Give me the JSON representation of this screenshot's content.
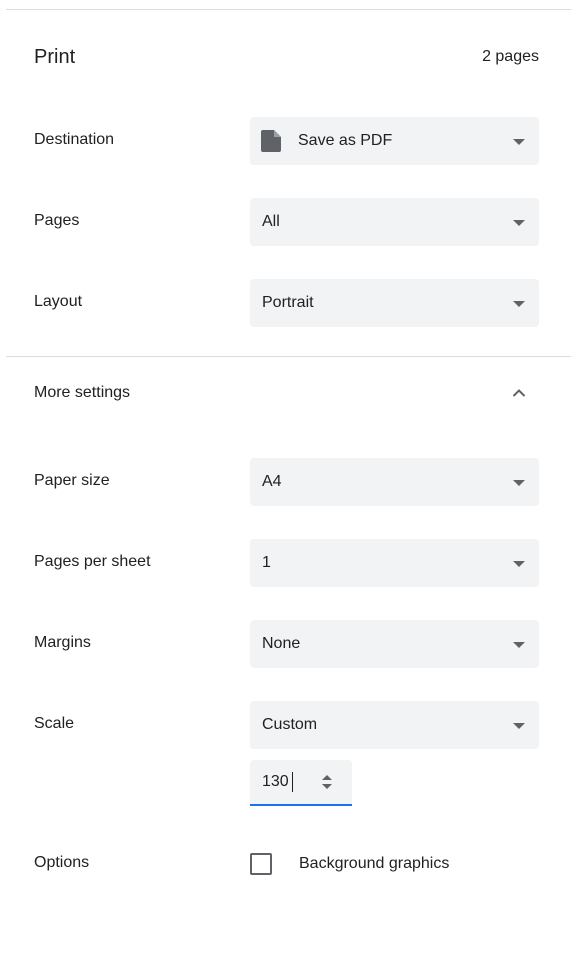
{
  "header": {
    "title": "Print",
    "page_count": "2 pages"
  },
  "rows": {
    "destination": {
      "label": "Destination",
      "value": "Save as PDF",
      "icon": "document-icon"
    },
    "pages": {
      "label": "Pages",
      "value": "All"
    },
    "layout": {
      "label": "Layout",
      "value": "Portrait"
    }
  },
  "more_settings": {
    "label": "More settings",
    "expanded": true
  },
  "advanced": {
    "paper_size": {
      "label": "Paper size",
      "value": "A4"
    },
    "pages_per_sheet": {
      "label": "Pages per sheet",
      "value": "1"
    },
    "margins": {
      "label": "Margins",
      "value": "None"
    },
    "scale": {
      "label": "Scale",
      "value": "Custom",
      "custom_value": "130"
    },
    "options": {
      "label": "Options",
      "background_graphics_label": "Background graphics",
      "background_graphics_checked": false
    }
  },
  "colors": {
    "select_bg": "#f1f3f4",
    "accent": "#1a73e8",
    "text": "#202124",
    "icon": "#5f6368"
  }
}
